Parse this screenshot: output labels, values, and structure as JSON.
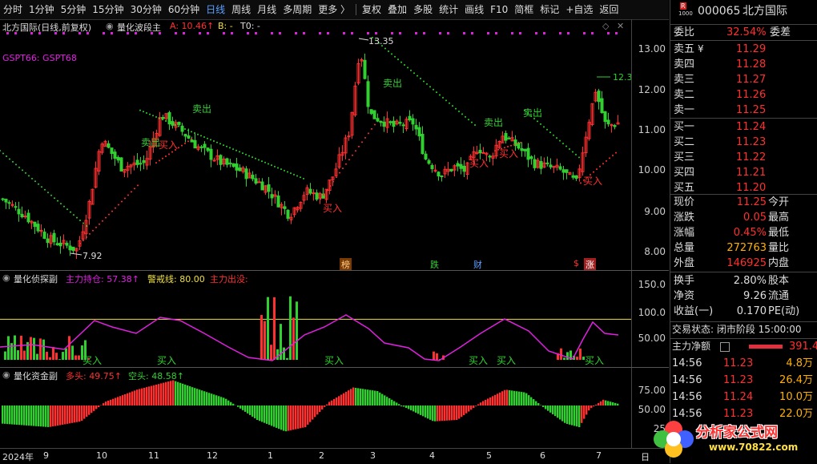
{
  "toolbar": {
    "items": [
      "分时",
      "1分钟",
      "5分钟",
      "15分钟",
      "30分钟",
      "60分钟",
      "日线",
      "周线",
      "月线",
      "多周期",
      "更多 〉",
      "复权",
      "叠加",
      "多股",
      "统计",
      "画线",
      "F10",
      "简框",
      "标记",
      "+自选",
      "返回"
    ]
  },
  "stock": {
    "code": "000065",
    "name": "北方国际",
    "badge_r": "R",
    "badge_num": "1000"
  },
  "main_panel": {
    "title": "北方国际(日线,前复权)",
    "indicator": "量化波段主",
    "a_label": "A: 10.46↑",
    "b_label": "B: -",
    "t0_label": "T0: -",
    "gspt": "GSPT66:  GSPT68",
    "high_label": "13.35",
    "low_label": "7.92",
    "right_label": "12.3",
    "axis": [
      "13.00",
      "12.00",
      "11.00",
      "10.00",
      "9.00",
      "8.00"
    ],
    "signals": {
      "sell": "卖出",
      "buy": "买入"
    },
    "event_tags": [
      "榜",
      "跌",
      "财",
      "$",
      "涨"
    ]
  },
  "sub1": {
    "title": "量化侦探副",
    "holding": "主力持仓: 57.38↑",
    "warn": "警戒线: 80.00",
    "exit": "主力出没:",
    "axis": [
      "150.0",
      "100.0",
      "50.00"
    ],
    "buy": "买入"
  },
  "sub2": {
    "title": "量化资金副",
    "long": "多头: 49.75↑",
    "short": "空头: 48.58↑",
    "axis": [
      "75.00",
      "50.00",
      "25"
    ]
  },
  "x_axis": {
    "labels": [
      "2024年",
      "9",
      "10",
      "11",
      "12",
      "1",
      "2",
      "3",
      "4",
      "5",
      "6",
      "7"
    ],
    "right": "日"
  },
  "quote": {
    "weibi_label": "委比",
    "weibi_value": "32.54%",
    "weicha_label": "委差",
    "sells": [
      {
        "l": "卖五",
        "v": "11.29",
        "mark": "¥"
      },
      {
        "l": "卖四",
        "v": "11.28"
      },
      {
        "l": "卖三",
        "v": "11.27"
      },
      {
        "l": "卖二",
        "v": "11.26"
      },
      {
        "l": "卖一",
        "v": "11.25"
      }
    ],
    "buys": [
      {
        "l": "买一",
        "v": "11.24"
      },
      {
        "l": "买二",
        "v": "11.23"
      },
      {
        "l": "买三",
        "v": "11.22"
      },
      {
        "l": "买四",
        "v": "11.21"
      },
      {
        "l": "买五",
        "v": "11.20"
      }
    ],
    "stats": [
      {
        "l": "现价",
        "v": "11.25",
        "r": "今开"
      },
      {
        "l": "涨跌",
        "v": "0.05",
        "r": "最高"
      },
      {
        "l": "涨幅",
        "v": "0.45%",
        "r": "最低"
      },
      {
        "l": "总量",
        "v": "272763",
        "r": "量比"
      },
      {
        "l": "外盘",
        "v": "146925",
        "r": "内盘"
      }
    ],
    "stats2": [
      {
        "l": "换手",
        "v": "2.80%",
        "r": "股本"
      },
      {
        "l": "净资",
        "v": "9.26",
        "r": "流通"
      },
      {
        "l": "收益(一)",
        "v": "0.170",
        "r": "PE(动)"
      }
    ],
    "status": "交易状态: 闭市阶段 15:00:00",
    "net_label": "主力净额",
    "net_value": "391.4",
    "ticks": [
      {
        "t": "14:56",
        "p": "11.23",
        "v": "4.8万"
      },
      {
        "t": "14:56",
        "p": "11.23",
        "v": "26.4万"
      },
      {
        "t": "14:56",
        "p": "11.24",
        "v": "10.0万"
      },
      {
        "t": "14:56",
        "p": "11.23",
        "v": "22.0万"
      }
    ]
  },
  "watermark": {
    "text": "分析家公式网",
    "url": "www.70822.com"
  },
  "colors": {
    "up": "#ff3030",
    "down": "#30d030",
    "yellow": "#f0e040",
    "magenta": "#e020e0",
    "orange": "#ffb000"
  }
}
